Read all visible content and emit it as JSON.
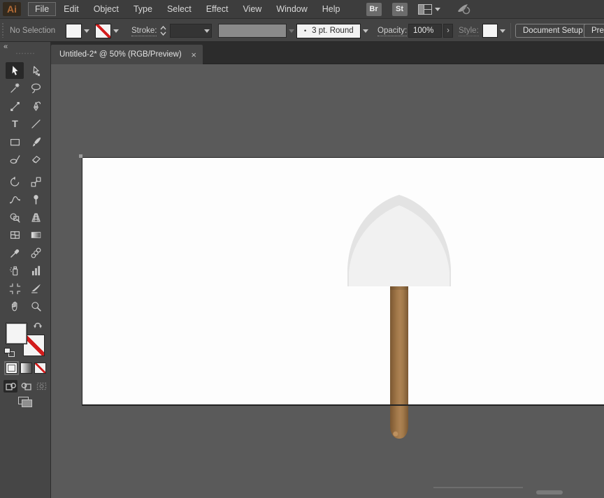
{
  "menubar": {
    "logo": "Ai",
    "menus": [
      "File",
      "Edit",
      "Object",
      "Type",
      "Select",
      "Effect",
      "View",
      "Window",
      "Help"
    ],
    "focused_menu": "File",
    "bridge_button": "Br",
    "stock_button": "St"
  },
  "controlbar": {
    "selection_status": "No Selection",
    "stroke_label": "Stroke:",
    "brush_bullet": "•",
    "brush_value": "3 pt. Round",
    "opacity_label": "Opacity:",
    "opacity_value": "100%",
    "forward_glyph": "›",
    "style_label": "Style:",
    "document_setup_label": "Document Setup",
    "preferences_label": "Preferences"
  },
  "tabbar": {
    "tab_title": "Untitled-2* @ 50% (RGB/Preview)",
    "close_glyph": "×"
  },
  "toolbar": {
    "collapse_glyph": "«",
    "active_tool": "selection-tool",
    "tools": [
      {
        "name": "selection-tool",
        "fly": false
      },
      {
        "name": "direct-selection-tool",
        "fly": true
      },
      {
        "name": "magic-wand-tool",
        "fly": false
      },
      {
        "name": "lasso-tool",
        "fly": true
      },
      {
        "name": "curvature-tool",
        "fly": true
      },
      {
        "name": "pen-tool",
        "fly": true
      },
      {
        "name": "type-tool",
        "fly": true
      },
      {
        "name": "line-segment-tool",
        "fly": true
      },
      {
        "name": "rectangle-tool",
        "fly": true
      },
      {
        "name": "paintbrush-tool",
        "fly": true
      },
      {
        "name": "shaper-tool",
        "fly": true
      },
      {
        "name": "eraser-tool",
        "fly": true
      },
      {
        "name": "rotate-tool",
        "fly": true
      },
      {
        "name": "scale-tool",
        "fly": true
      },
      {
        "name": "width-tool",
        "fly": true
      },
      {
        "name": "free-transform-tool",
        "fly": true
      },
      {
        "name": "shape-builder-tool",
        "fly": true
      },
      {
        "name": "perspective-grid-tool",
        "fly": true
      },
      {
        "name": "mesh-tool",
        "fly": false
      },
      {
        "name": "gradient-tool",
        "fly": false
      },
      {
        "name": "eyedropper-tool",
        "fly": true
      },
      {
        "name": "blend-tool",
        "fly": false
      },
      {
        "name": "symbol-sprayer-tool",
        "fly": true
      },
      {
        "name": "column-graph-tool",
        "fly": true
      },
      {
        "name": "artboard-tool",
        "fly": false
      },
      {
        "name": "slice-tool",
        "fly": true
      },
      {
        "name": "hand-tool",
        "fly": true
      },
      {
        "name": "zoom-tool",
        "fly": false
      }
    ]
  },
  "colors": {
    "none_red": "#d21c1c",
    "accent_logo": "#b06a36"
  },
  "artwork": {
    "description": "shovel",
    "head_outer_color": "#e3e3e3",
    "head_inner_color": "#f1f1f1",
    "handle": {
      "edge": "#7a5833",
      "dark": "#8a633a",
      "mid": "#a2794a",
      "light": "#ad8253",
      "tip_highlight": "#bd9160"
    },
    "artboard_color": "#fdfdfd"
  }
}
